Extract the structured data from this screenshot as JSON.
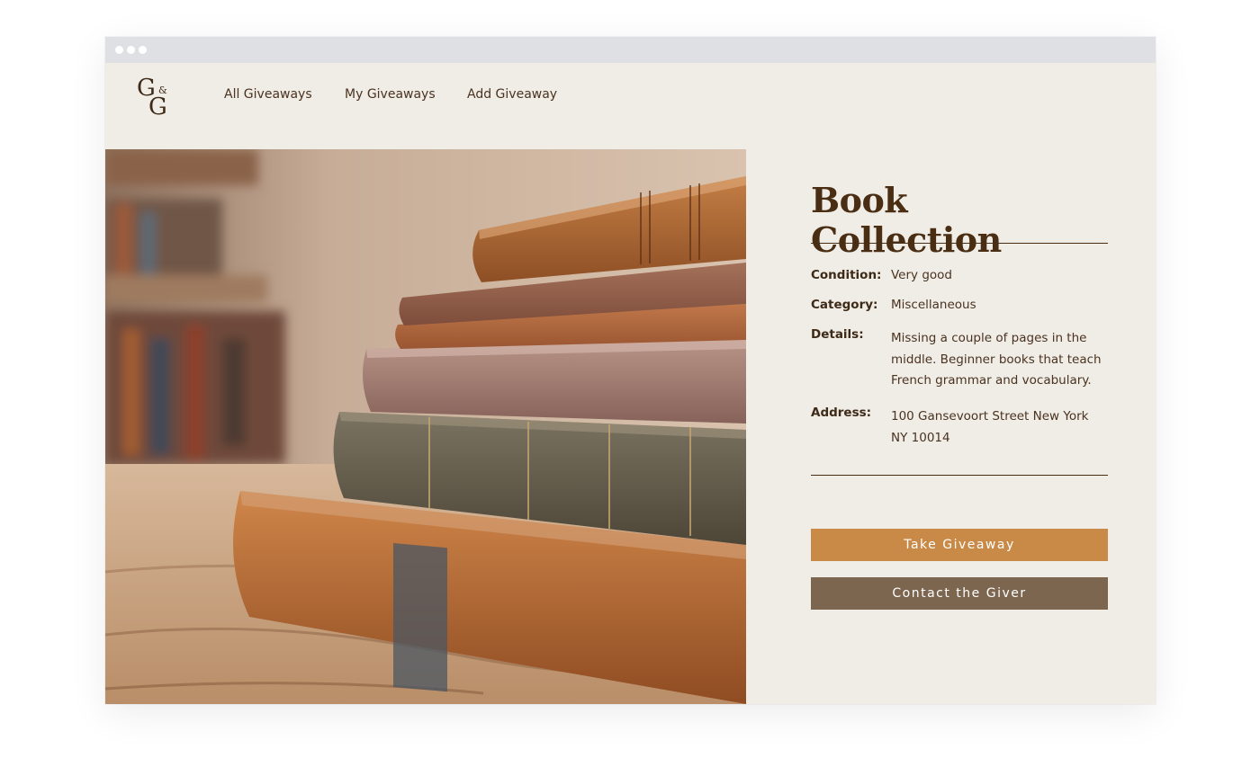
{
  "logo": {
    "letter_top": "G",
    "ampersand": "&",
    "letter_bottom": "G"
  },
  "nav": [
    {
      "label": "All Giveaways"
    },
    {
      "label": "My Giveaways"
    },
    {
      "label": "Add Giveaway"
    }
  ],
  "item": {
    "title": "Book Collection",
    "condition_label": "Condition:",
    "condition_value": "Very good",
    "category_label": "Category:",
    "category_value": "Miscellaneous",
    "details_label": "Details:",
    "details_value": "Missing a couple of pages in the middle. Beginner books that teach French grammar and vocabulary.",
    "address_label": "Address:",
    "address_value": "100 Gansevoort Street New York NY 10014"
  },
  "actions": {
    "take_label": "Take Giveaway",
    "contact_label": "Contact the Giver"
  },
  "colors": {
    "background": "#f0ece6",
    "heading": "#4a2e14",
    "primary_button": "#c98a48",
    "secondary_button": "#7d6650"
  },
  "image": {
    "subject": "stack of old leather-bound books"
  }
}
